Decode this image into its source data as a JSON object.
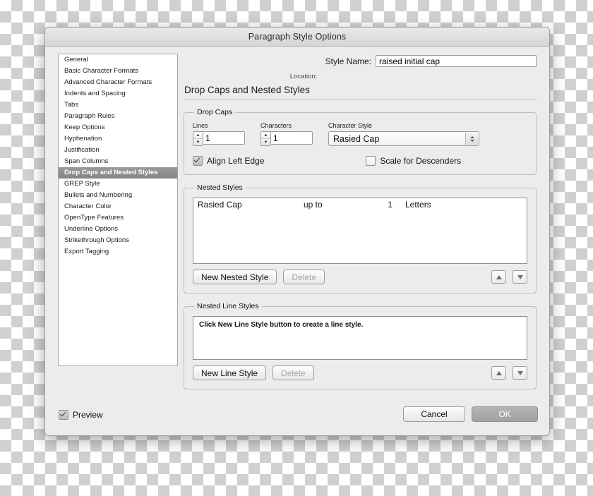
{
  "window": {
    "title": "Paragraph Style Options"
  },
  "sidebar": {
    "items": [
      {
        "label": "General",
        "selected": false
      },
      {
        "label": "Basic Character Formats",
        "selected": false
      },
      {
        "label": "Advanced Character Formats",
        "selected": false
      },
      {
        "label": "Indents and Spacing",
        "selected": false
      },
      {
        "label": "Tabs",
        "selected": false
      },
      {
        "label": "Paragraph Rules",
        "selected": false
      },
      {
        "label": "Keep Options",
        "selected": false
      },
      {
        "label": "Hyphenation",
        "selected": false
      },
      {
        "label": "Justification",
        "selected": false
      },
      {
        "label": "Span Columns",
        "selected": false
      },
      {
        "label": "Drop Caps and Nested Styles",
        "selected": true
      },
      {
        "label": "GREP Style",
        "selected": false
      },
      {
        "label": "Bullets and Numbering",
        "selected": false
      },
      {
        "label": "Character Color",
        "selected": false
      },
      {
        "label": "OpenType Features",
        "selected": false
      },
      {
        "label": "Underline Options",
        "selected": false
      },
      {
        "label": "Strikethrough Options",
        "selected": false
      },
      {
        "label": "Export Tagging",
        "selected": false
      }
    ]
  },
  "header": {
    "style_name_label": "Style Name:",
    "style_name_value": "raised initial cap",
    "location_label": "Location:",
    "panel_title": "Drop Caps and Nested Styles"
  },
  "drop_caps": {
    "legend": "Drop Caps",
    "lines_label": "Lines",
    "lines_value": "1",
    "characters_label": "Characters",
    "characters_value": "1",
    "character_style_label": "Character Style",
    "character_style_value": "Rasied Cap",
    "align_left_edge_label": "Align Left Edge",
    "align_left_edge_checked": true,
    "scale_for_descenders_label": "Scale for Descenders",
    "scale_for_descenders_checked": false
  },
  "nested_styles": {
    "legend": "Nested Styles",
    "rows": [
      {
        "style": "Rasied Cap",
        "relation": "up to",
        "count": "1",
        "unit": "Letters"
      }
    ],
    "new_button": "New Nested Style",
    "delete_button": "Delete",
    "up_icon": "triangle-up-icon",
    "down_icon": "triangle-down-icon"
  },
  "nested_line_styles": {
    "legend": "Nested Line Styles",
    "hint": "Click New Line Style button to create a line style.",
    "new_button": "New Line Style",
    "delete_button": "Delete",
    "up_icon": "triangle-up-icon",
    "down_icon": "triangle-down-icon"
  },
  "footer": {
    "preview_label": "Preview",
    "preview_checked": true,
    "cancel_label": "Cancel",
    "ok_label": "OK"
  },
  "colors": {
    "dialog_bg": "#ececec",
    "selection": "#8d8d8d",
    "default_button": "#a9a9a9"
  }
}
